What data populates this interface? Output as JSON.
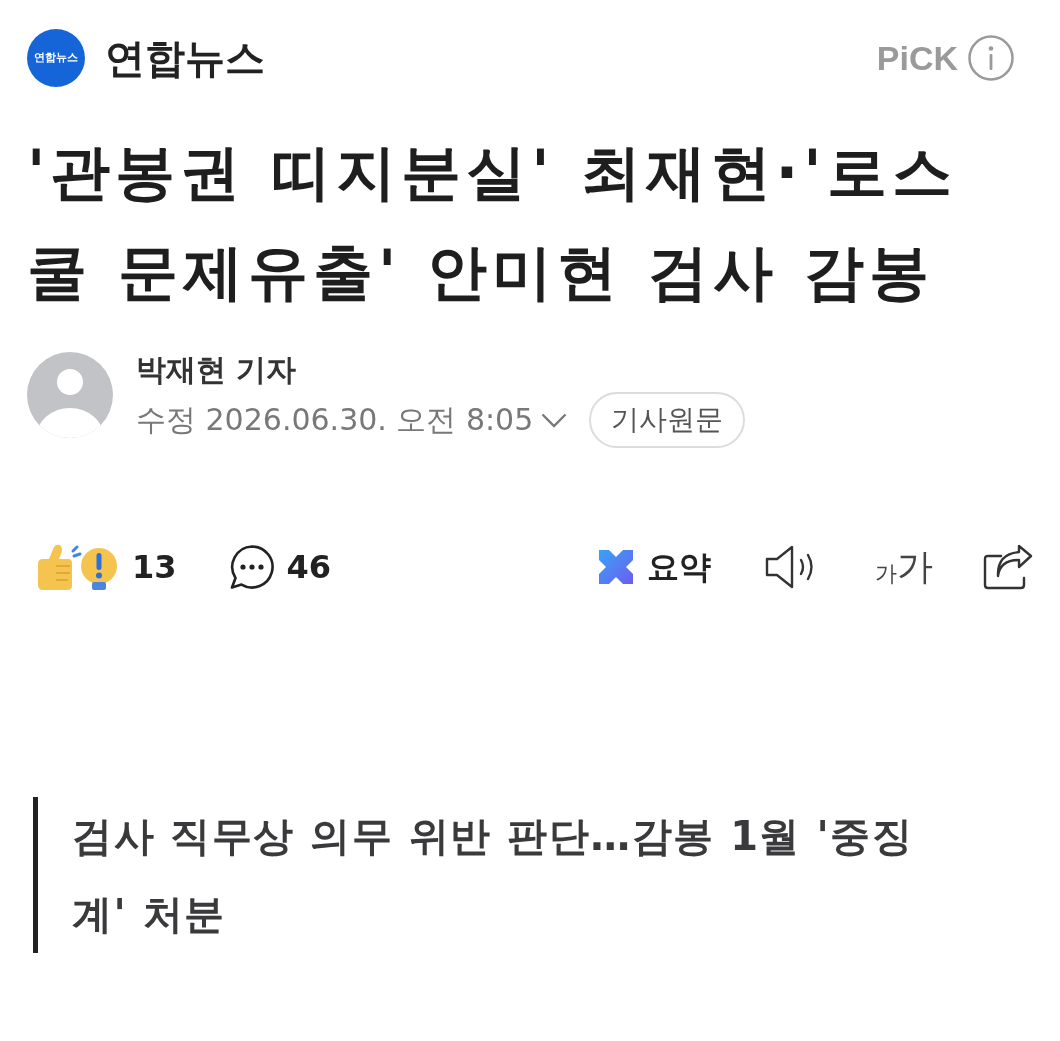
{
  "publisher": {
    "logo_text": "연합뉴스",
    "name": "연합뉴스",
    "pick_label": "PiCK"
  },
  "headline": "'관봉권 띠지분실' 최재현·'로스쿨 문제유출' 안미현 검사 감봉",
  "byline": {
    "reporter": "박재현 기자",
    "date": "수정 2026.06.30. 오전 8:05",
    "original_button": "기사원문"
  },
  "actions": {
    "reactions": "13",
    "comments": "46",
    "summary": "요약",
    "font_size": {
      "small": "가",
      "large": "가"
    }
  },
  "subtitle": "검사 직무상 의무 위반 판단…감봉 1월 '중징계' 처분"
}
